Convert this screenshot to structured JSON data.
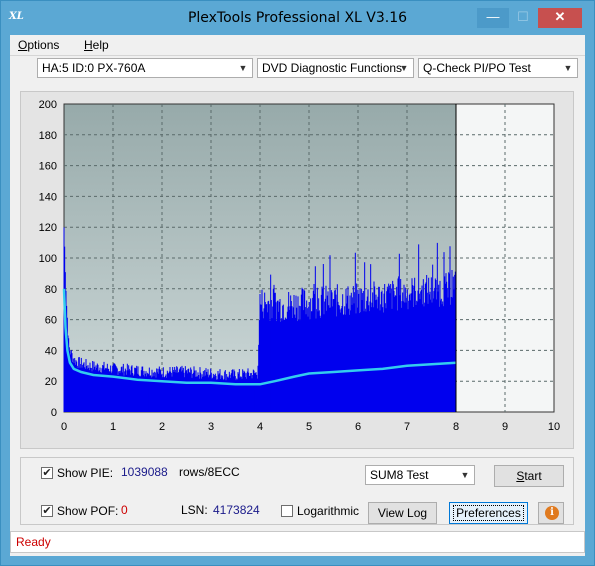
{
  "window": {
    "logo_text": "XL",
    "title": "PlexTools Professional XL V3.16",
    "min_glyph": "—",
    "max_glyph": "☐",
    "close_glyph": "✕"
  },
  "menu": {
    "options_first": "O",
    "options_rest": "ptions",
    "help_first": "H",
    "help_rest": "elp"
  },
  "toolbar": {
    "drive": "HA:5 ID:0  PX-760A",
    "function": "DVD Diagnostic Functions",
    "test": "Q-Check PI/PO Test",
    "arrow": "▼"
  },
  "chart_data": {
    "type": "area",
    "xlim": [
      0,
      10
    ],
    "ylim": [
      0,
      200
    ],
    "x_ticks": [
      "0",
      "1",
      "2",
      "3",
      "4",
      "5",
      "6",
      "7",
      "8",
      "9",
      "10"
    ],
    "y_ticks": [
      "0",
      "20",
      "40",
      "60",
      "80",
      "100",
      "120",
      "140",
      "160",
      "180",
      "200"
    ],
    "grid": true,
    "marker_x": 8,
    "series": [
      {
        "kind": "PIE bars",
        "color": "#0000ee",
        "x": [
          0.0,
          0.05,
          0.1,
          0.2,
          0.3,
          0.5,
          0.8,
          1.0,
          1.5,
          2.0,
          2.5,
          3.0,
          3.5,
          3.9,
          3.95,
          4.0,
          4.5,
          5.0,
          5.5,
          6.0,
          6.5,
          7.0,
          7.3,
          7.6,
          7.9,
          8.0
        ],
        "y": [
          118,
          70,
          40,
          32,
          30,
          28,
          27,
          26,
          25,
          24,
          24,
          23,
          22,
          23,
          23,
          66,
          64,
          66,
          67,
          68,
          70,
          72,
          74,
          74,
          75,
          80
        ]
      },
      {
        "kind": "PIE average line",
        "color": "#33ccee",
        "x": [
          0.0,
          0.03,
          0.07,
          0.12,
          0.2,
          0.35,
          0.6,
          1.0,
          1.5,
          2.0,
          2.5,
          3.0,
          3.5,
          4.0,
          4.3,
          4.7,
          5.0,
          5.5,
          6.0,
          6.5,
          7.0,
          7.5,
          8.0
        ],
        "y": [
          80,
          55,
          40,
          32,
          28,
          26,
          24,
          23,
          21,
          20,
          19,
          19,
          18,
          18,
          20,
          23,
          25,
          26,
          27,
          28,
          30,
          31,
          32
        ]
      }
    ]
  },
  "panel": {
    "show_pie_label": "Show PIE:",
    "pie_value": "1039088",
    "pie_unit": "rows/8ECC",
    "show_poe_label": "Show POF:",
    "poe_value": "0",
    "lsn_label": "LSN:",
    "lsn_value": "4173824",
    "log_label": "Logarithmic",
    "sum_select": "SUM8 Test",
    "start_first": "S",
    "start_rest": "tart",
    "view_log": "View Log",
    "preferences": "Preferences",
    "check_glyph": "✔",
    "info_glyph": "i"
  },
  "status": {
    "text": "Ready"
  }
}
